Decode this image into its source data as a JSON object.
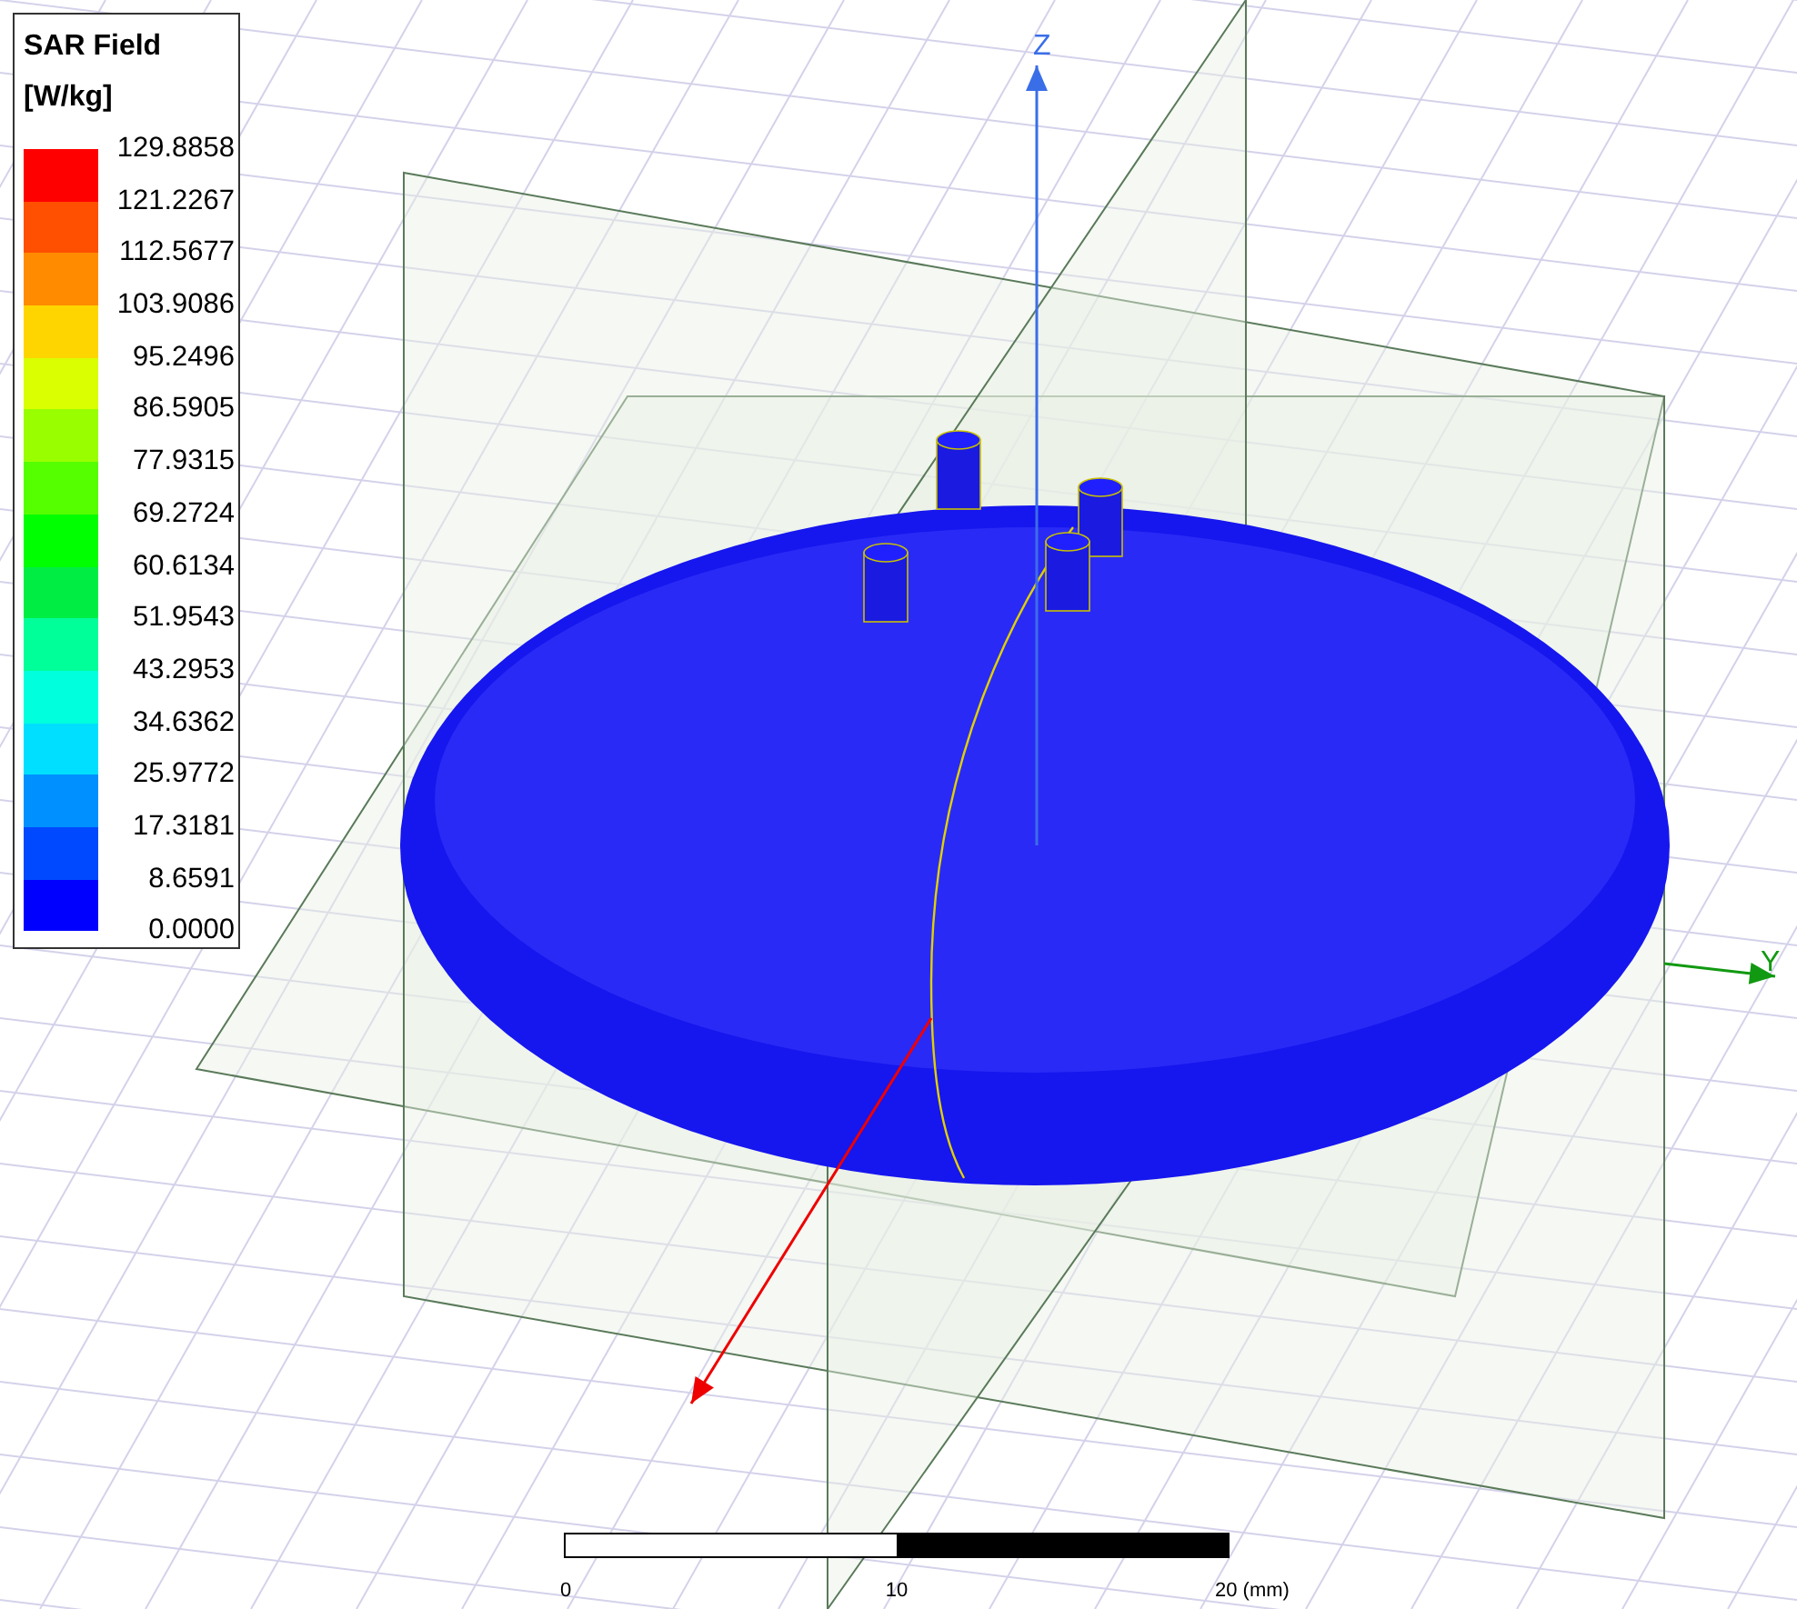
{
  "legend": {
    "title": "SAR Field",
    "unit": "[W/kg]",
    "values": [
      "129.8858",
      "121.2267",
      "112.5677",
      "103.9086",
      "95.2496",
      "86.5905",
      "77.9315",
      "69.2724",
      "60.6134",
      "51.9543",
      "43.2953",
      "34.6362",
      "25.9772",
      "17.3181",
      "8.6591",
      "0.0000"
    ],
    "bands": [
      {
        "color": "#ff0000"
      },
      {
        "color": "#ff4f00"
      },
      {
        "color": "#ff8c00"
      },
      {
        "color": "#ffd500"
      },
      {
        "color": "#d9ff00"
      },
      {
        "color": "#99ff00"
      },
      {
        "color": "#55ff00"
      },
      {
        "color": "#00ff00"
      },
      {
        "color": "#00ee44"
      },
      {
        "color": "#00ff99"
      },
      {
        "color": "#00ffdd"
      },
      {
        "color": "#00dfff"
      },
      {
        "color": "#0090ff"
      },
      {
        "color": "#0049ff"
      },
      {
        "color": "#0000ff"
      }
    ]
  },
  "axes": [
    {
      "kind": "z",
      "label": "Z"
    },
    {
      "kind": "y",
      "label": "Y"
    },
    {
      "kind": "x"
    }
  ],
  "scale_bar": {
    "labels": [
      "0",
      "10",
      "20 (mm)"
    ]
  }
}
